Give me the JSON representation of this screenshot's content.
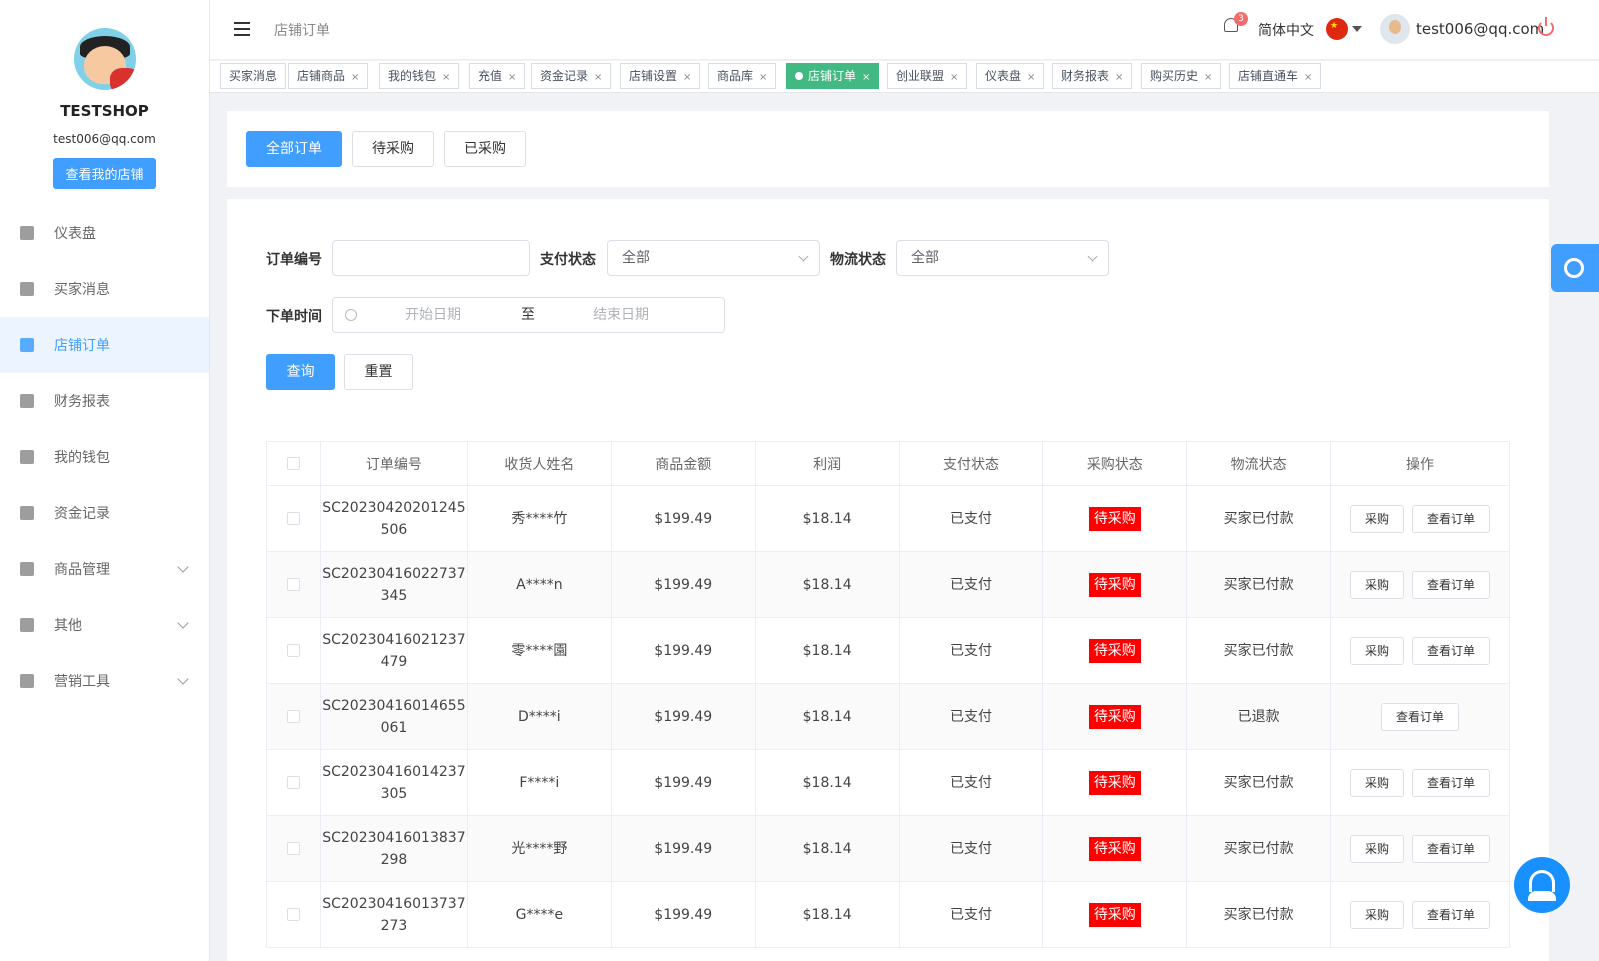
{
  "sidebar": {
    "shop_name": "TESTSHOP",
    "email": "test006@qq.com",
    "view_shop_label": "查看我的店铺",
    "items": [
      {
        "label": "仪表盘",
        "icon": "dashboard-icon"
      },
      {
        "label": "买家消息",
        "icon": "message-icon"
      },
      {
        "label": "店铺订单",
        "icon": "clipboard-icon",
        "active": true
      },
      {
        "label": "财务报表",
        "icon": "chart-icon"
      },
      {
        "label": "我的钱包",
        "icon": "wallet-icon"
      },
      {
        "label": "资金记录",
        "icon": "document-icon"
      },
      {
        "label": "商品管理",
        "icon": "briefcase-icon",
        "expandable": true
      },
      {
        "label": "其他",
        "icon": "grid-icon",
        "expandable": true
      },
      {
        "label": "营销工具",
        "icon": "bar-chart-icon",
        "expandable": true
      }
    ]
  },
  "header": {
    "breadcrumb": "店铺订单",
    "notification_count": "3",
    "language": "简体中文",
    "user_email": "test006@qq.com"
  },
  "tags": [
    {
      "label": "买家消息"
    },
    {
      "label": "店铺商品"
    },
    {
      "label": "我的钱包"
    },
    {
      "label": "充值"
    },
    {
      "label": "资金记录"
    },
    {
      "label": "店铺设置"
    },
    {
      "label": "商品库"
    },
    {
      "label": "店铺订单",
      "active": true
    },
    {
      "label": "创业联盟"
    },
    {
      "label": "仪表盘"
    },
    {
      "label": "财务报表"
    },
    {
      "label": "购买历史"
    },
    {
      "label": "店铺直通车"
    }
  ],
  "order_tabs": {
    "all": "全部订单",
    "pending": "待采购",
    "purchased": "已采购"
  },
  "filters": {
    "order_no_label": "订单编号",
    "order_no_value": "",
    "pay_status_label": "支付状态",
    "pay_status_value": "全部",
    "logistics_label": "物流状态",
    "logistics_value": "全部",
    "order_time_label": "下单时间",
    "start_placeholder": "开始日期",
    "range_sep": "至",
    "end_placeholder": "结束日期",
    "query_label": "查询",
    "reset_label": "重置"
  },
  "table": {
    "headers": [
      "订单编号",
      "收货人姓名",
      "商品金额",
      "利润",
      "支付状态",
      "采购状态",
      "物流状态",
      "操作"
    ],
    "purchase_label": "采购",
    "view_label": "查看订单",
    "rows": [
      {
        "order_no_1": "SC20230420201245",
        "order_no_2": "506",
        "name": "秀****竹",
        "amount": "$199.49",
        "profit": "$18.14",
        "pay": "已支付",
        "purchase": "待采购",
        "logistics": "买家已付款",
        "can_purchase": true
      },
      {
        "order_no_1": "SC20230416022737",
        "order_no_2": "345",
        "name": "A****n",
        "amount": "$199.49",
        "profit": "$18.14",
        "pay": "已支付",
        "purchase": "待采购",
        "logistics": "买家已付款",
        "can_purchase": true
      },
      {
        "order_no_1": "SC20230416021237",
        "order_no_2": "479",
        "name": "零****園",
        "amount": "$199.49",
        "profit": "$18.14",
        "pay": "已支付",
        "purchase": "待采购",
        "logistics": "买家已付款",
        "can_purchase": true
      },
      {
        "order_no_1": "SC20230416014655",
        "order_no_2": "061",
        "name": "D****i",
        "amount": "$199.49",
        "profit": "$18.14",
        "pay": "已支付",
        "purchase": "待采购",
        "logistics": "已退款",
        "can_purchase": false
      },
      {
        "order_no_1": "SC20230416014237",
        "order_no_2": "305",
        "name": "F****i",
        "amount": "$199.49",
        "profit": "$18.14",
        "pay": "已支付",
        "purchase": "待采购",
        "logistics": "买家已付款",
        "can_purchase": true
      },
      {
        "order_no_1": "SC20230416013837",
        "order_no_2": "298",
        "name": "光****野",
        "amount": "$199.49",
        "profit": "$18.14",
        "pay": "已支付",
        "purchase": "待采购",
        "logistics": "买家已付款",
        "can_purchase": true
      },
      {
        "order_no_1": "SC20230416013737",
        "order_no_2": "273",
        "name": "G****e",
        "amount": "$199.49",
        "profit": "$18.14",
        "pay": "已支付",
        "purchase": "待采购",
        "logistics": "买家已付款",
        "can_purchase": true
      }
    ]
  },
  "colors": {
    "primary": "#409eff",
    "active_tag": "#42b983",
    "pending_badge": "#ff0000"
  }
}
